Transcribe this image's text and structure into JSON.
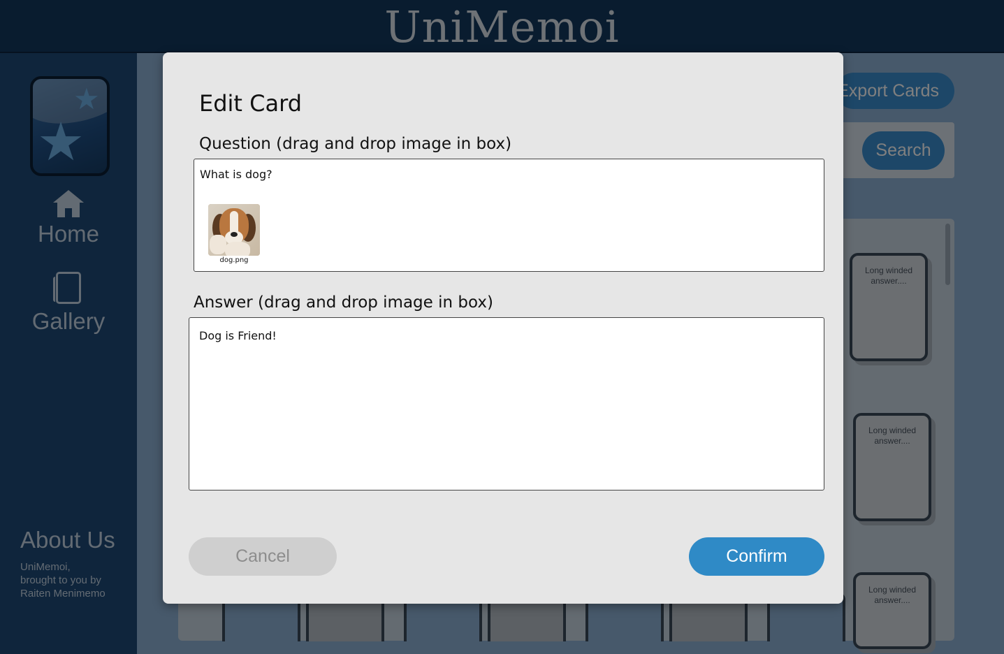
{
  "app": {
    "title": "UniMemoi"
  },
  "sidebar": {
    "logo_icon": "star-logo-icon",
    "items": [
      {
        "label": "Home",
        "icon": "home-icon"
      },
      {
        "label": "Gallery",
        "icon": "card-icon"
      }
    ],
    "about": {
      "title": "About Us",
      "lines": [
        "UniMemoi,",
        "brought to you by",
        "Raiten Menimemo"
      ]
    }
  },
  "main": {
    "export_label": "Export Cards",
    "search_label": "Search",
    "cards": [
      {
        "text": "Long winded answer...."
      },
      {
        "text": "Long winded answer...."
      },
      {
        "text": "Long winded answer...."
      }
    ]
  },
  "modal": {
    "title": "Edit Card",
    "question_label": "Question (drag and drop image in box)",
    "question_text": "What is dog?",
    "attachment_name": "dog.png",
    "answer_label": "Answer (drag and drop image in box)",
    "answer_text": "Dog is Friend!",
    "cancel_label": "Cancel",
    "confirm_label": "Confirm"
  },
  "colors": {
    "header": "#12385f",
    "accent": "#2f8ac6",
    "modal_bg": "#e6e6e6"
  }
}
